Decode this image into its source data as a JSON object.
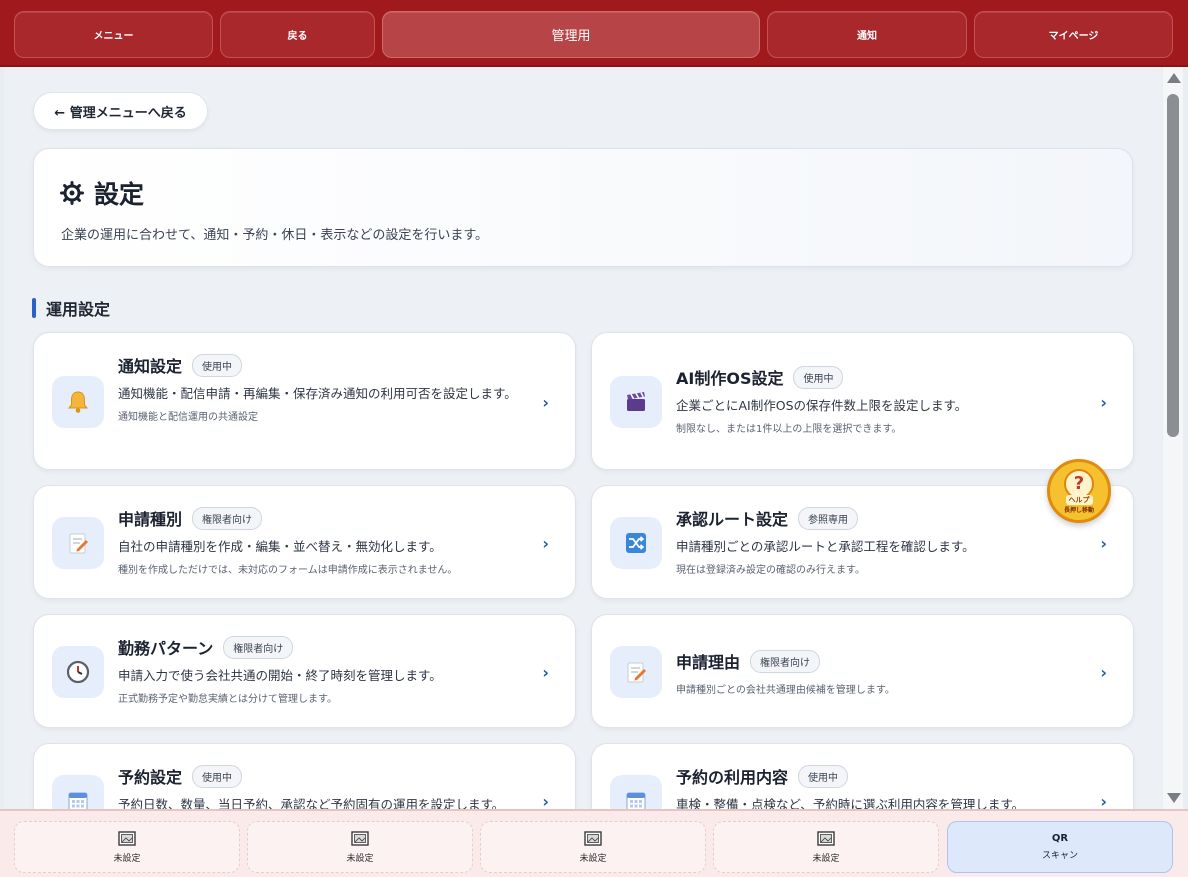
{
  "topnav": {
    "menu": "メニュー",
    "back": "戻る",
    "admin": "管理用",
    "notify": "通知",
    "mypage": "マイページ"
  },
  "back_link": "← 管理メニューへ戻る",
  "header": {
    "icon": "gear-icon",
    "title": "設定",
    "description": "企業の運用に合わせて、通知・予約・休日・表示などの設定を行います。"
  },
  "section": {
    "title": "運用設定",
    "accent": "#2a63c4"
  },
  "cards": [
    {
      "name": "通知設定",
      "badge": "使用中",
      "icon": "bell-icon",
      "line1": "通知機能・配信申請・再編集・保存済み通知の利用可否を設定します。",
      "line2": "通知機能と配信運用の共通設定"
    },
    {
      "name": "AI制作OS設定",
      "badge": "使用中",
      "icon": "clapperboard-icon",
      "line1": "企業ごとにAI制作OSの保存件数上限を設定します。",
      "line2": "制限なし、または1件以上の上限を選択できます。"
    },
    {
      "name": "申請種別",
      "badge": "権限者向け",
      "icon": "memo-icon",
      "line1": "自社の申請種別を作成・編集・並べ替え・無効化します。",
      "line2": "種別を作成しただけでは、未対応のフォームは申請作成に表示されません。"
    },
    {
      "name": "承認ルート設定",
      "badge": "参照専用",
      "icon": "shuffle-icon",
      "line1": "申請種別ごとの承認ルートと承認工程を確認します。",
      "line2": "現在は登録済み設定の確認のみ行えます。"
    },
    {
      "name": "勤務パターン",
      "badge": "権限者向け",
      "icon": "clock-icon",
      "line1": "申請入力で使う会社共通の開始・終了時刻を管理します。",
      "line2": "正式勤務予定や勤怠実績とは分けて管理します。"
    },
    {
      "name": "申請理由",
      "badge": "権限者向け",
      "icon": "memo-icon",
      "line1": "",
      "line2": "申請種別ごとの会社共通理由候補を管理します。"
    },
    {
      "name": "予約設定",
      "badge": "使用中",
      "icon": "calendar-icon",
      "line1": "予約日数、数量、当日予約、承認など予約固有の運用を設定します。",
      "line2": ""
    },
    {
      "name": "予約の利用内容",
      "badge": "使用中",
      "icon": "calendar-icon",
      "line1": "車検・整備・点検など、予約時に選ぶ利用内容を管理します。",
      "line2": ""
    }
  ],
  "help": {
    "label": "ヘルプ",
    "sub": "長押し移動"
  },
  "bottom": {
    "slots": [
      "未設定",
      "未設定",
      "未設定",
      "未設定"
    ],
    "qr_title": "QR",
    "qr_sub": "スキャン"
  },
  "colors": {
    "topbar": "#a0191d",
    "bottombar": "#fbeaea",
    "qr": "#dde8fb"
  }
}
